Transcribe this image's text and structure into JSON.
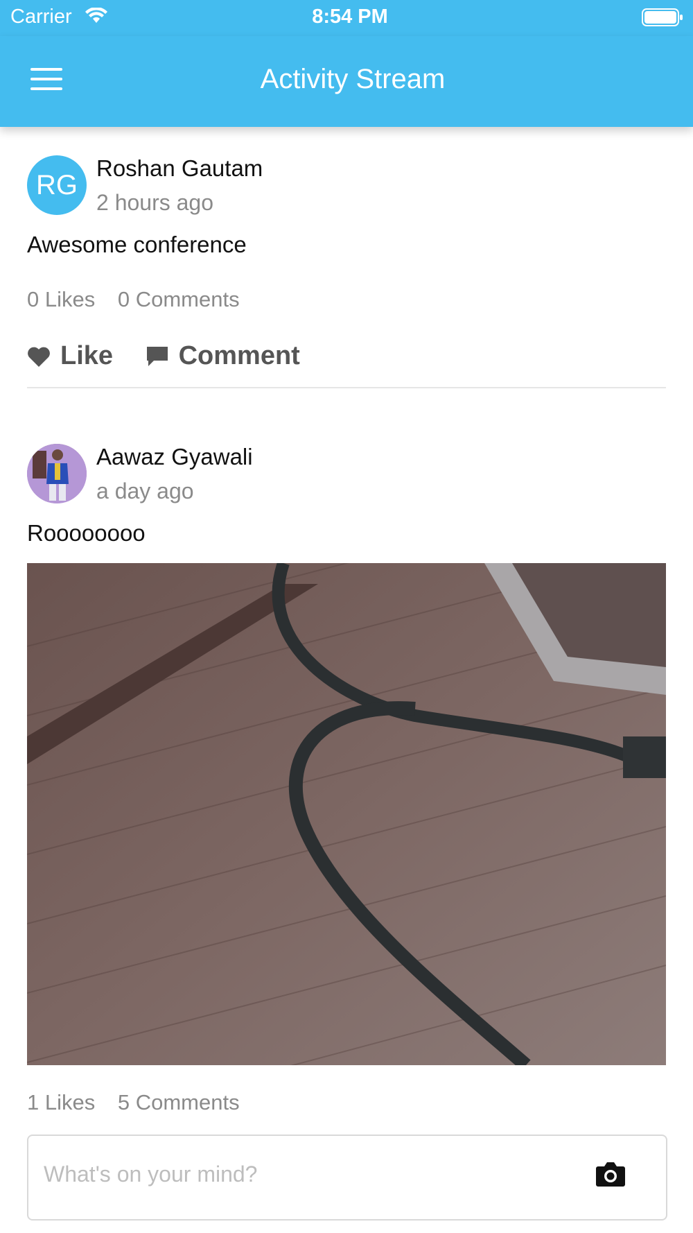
{
  "status_bar": {
    "carrier": "Carrier",
    "time": "8:54 PM"
  },
  "header": {
    "title": "Activity Stream"
  },
  "posts": [
    {
      "initials": "RG",
      "author": "Roshan Gautam",
      "time_ago": "2 hours ago",
      "text": "Awesome conference",
      "likes": "0 Likes",
      "comments": "0 Comments",
      "like_label": "Like",
      "comment_label": "Comment"
    },
    {
      "author": "Aawaz Gyawali",
      "time_ago": "a day ago",
      "text": "Roooooooo",
      "likes": "1 Likes",
      "comments": "5 Comments"
    }
  ],
  "composer": {
    "placeholder": "What's on your mind?"
  },
  "colors": {
    "accent": "#44bcef",
    "muted": "#8a8a8a",
    "action": "#555555"
  },
  "icons": [
    "wifi-icon",
    "battery-icon",
    "menu-icon",
    "heart-icon",
    "comment-icon",
    "camera-icon"
  ]
}
